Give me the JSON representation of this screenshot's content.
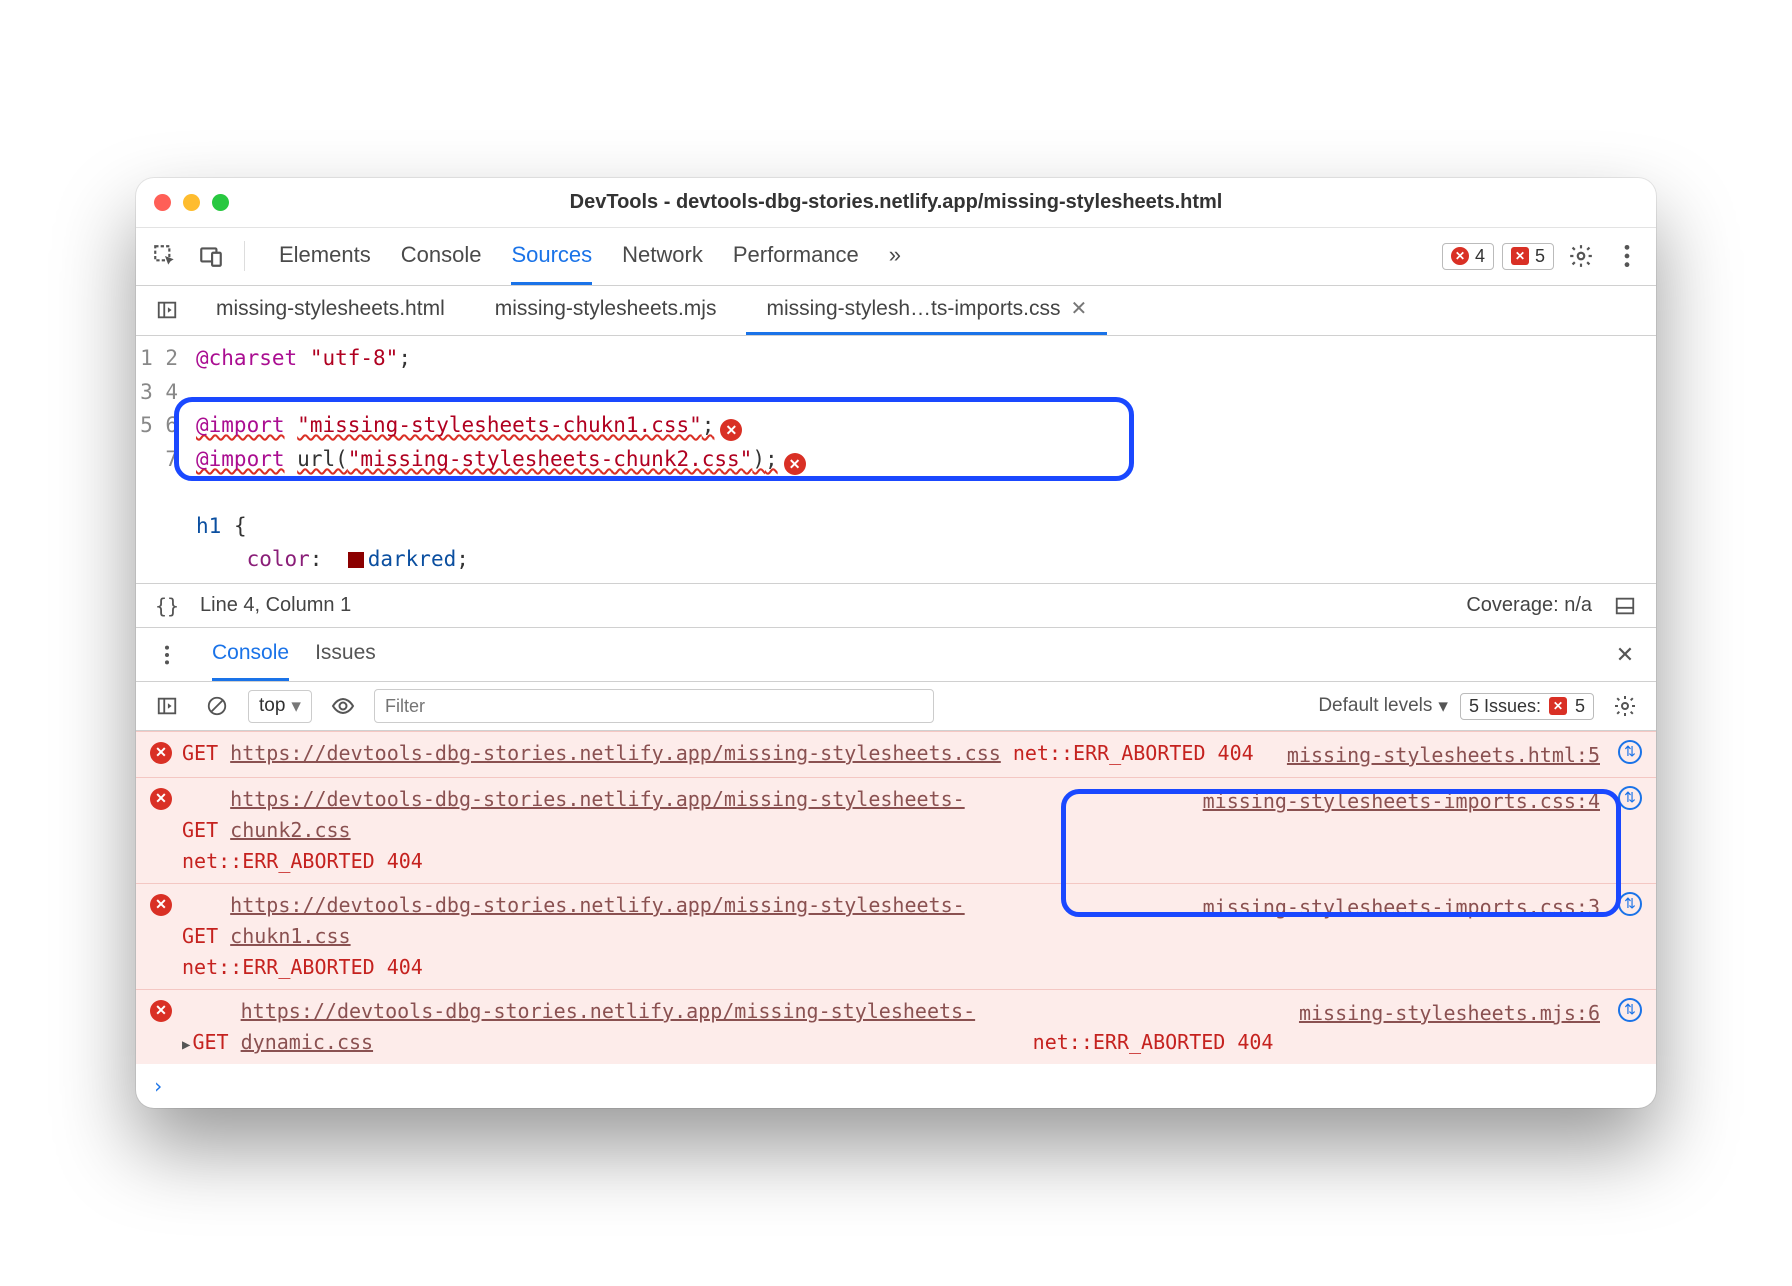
{
  "window": {
    "title": "DevTools - devtools-dbg-stories.netlify.app/missing-stylesheets.html"
  },
  "main_tabs": {
    "elements": "Elements",
    "console": "Console",
    "sources": "Sources",
    "network": "Network",
    "performance": "Performance",
    "more": "»"
  },
  "error_counts": {
    "circle": "4",
    "square": "5"
  },
  "file_tabs": {
    "t1": "missing-stylesheets.html",
    "t2": "missing-stylesheets.mjs",
    "t3": "missing-stylesh…ts-imports.css"
  },
  "code": {
    "l1_kw": "@charset",
    "l1_str": "\"utf-8\"",
    "l3_kw": "@import",
    "l3_str": "\"missing-stylesheets-chukn1.css\"",
    "l4_kw": "@import",
    "l4_fn": "url(",
    "l4_str": "\"missing-stylesheets-chunk2.css\"",
    "l4_cp": ")",
    "l6_sel": "h1",
    "l6_br": " {",
    "l7_prop": "color",
    "l7_val": "darkred"
  },
  "statusbar": {
    "pos": "Line 4, Column 1",
    "coverage": "Coverage: n/a"
  },
  "drawer": {
    "console": "Console",
    "issues": "Issues"
  },
  "console_tb": {
    "context": "top",
    "filter_ph": "Filter",
    "levels": "Default levels",
    "issues_label": "5 Issues:",
    "issues_count": "5"
  },
  "console_msgs": [
    {
      "method": "GET",
      "url": "https://devtools-dbg-stories.netlify.app/missing-stylesheets.css",
      "err": "net::ERR_ABORTED 404",
      "src": "missing-stylesheets.html:5",
      "expand": false
    },
    {
      "method": "GET",
      "url": "https://devtools-dbg-stories.netlify.app/missing-stylesheets-chunk2.css",
      "err": "net::ERR_ABORTED 404",
      "src": "missing-stylesheets-imports.css:4",
      "expand": false
    },
    {
      "method": "GET",
      "url": "https://devtools-dbg-stories.netlify.app/missing-stylesheets-chukn1.css",
      "err": "net::ERR_ABORTED 404",
      "src": "missing-stylesheets-imports.css:3",
      "expand": false
    },
    {
      "method": "GET",
      "url": "https://devtools-dbg-stories.netlify.app/missing-stylesheets-dynamic.css",
      "err": "net::ERR_ABORTED 404",
      "src": "missing-stylesheets.mjs:6",
      "expand": true
    }
  ],
  "prompt": "›"
}
